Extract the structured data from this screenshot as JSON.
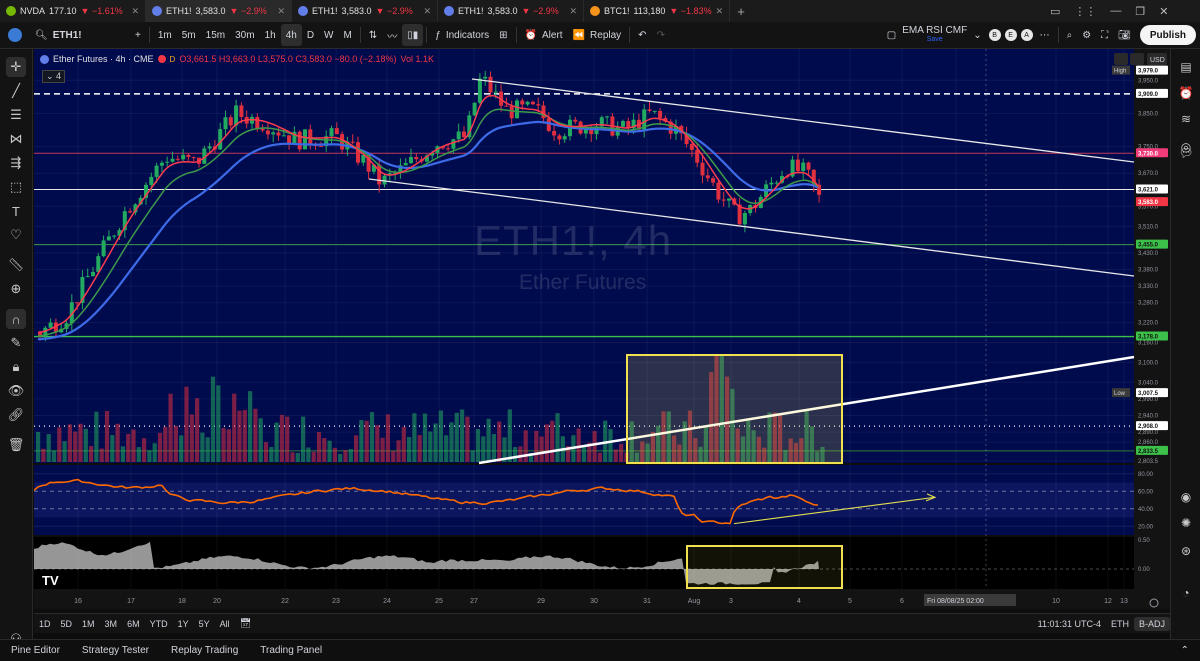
{
  "browser_tabs": [
    {
      "symbol": "NVDA",
      "price": "177.10",
      "change": "▼ −1.61%",
      "color": "#76b900"
    },
    {
      "symbol": "ETH1!",
      "price": "3,583.0",
      "change": "▼ −2.9%",
      "color": "#627eea",
      "active": true
    },
    {
      "symbol": "ETH1!",
      "price": "3,583.0",
      "change": "▼ −2.9%",
      "color": "#627eea"
    },
    {
      "symbol": "ETH1!",
      "price": "3,583.0",
      "change": "▼ −2.9%",
      "color": "#627eea"
    },
    {
      "symbol": "BTC1!",
      "price": "113,180",
      "change": "▼ −1.83%",
      "color": "#f7931a"
    }
  ],
  "toolbar": {
    "symbol": "ETH1!",
    "intervals": [
      "1m",
      "5m",
      "15m",
      "30m",
      "1h",
      "4h",
      "D",
      "W",
      "M"
    ],
    "selected_interval": "4h",
    "indicators_label": "Indicators",
    "alert_label": "Alert",
    "replay_label": "Replay",
    "layout_name": "EMA RSI CMF",
    "layout_status": "Save",
    "letters": [
      "B",
      "E",
      "A"
    ],
    "publish_label": "Publish"
  },
  "chart": {
    "title": "Ether Futures · 4h · CME",
    "ohlc": "O3,661.5  H3,663.0  L3,575.0  C3,583.0  −80.0 (−2.18%)",
    "vol": "Vol 1.1K",
    "collapse_count": "4",
    "watermark_symbol": "ETH1!, 4h",
    "watermark_name": "Ether Futures",
    "price_ticks": [
      "3,950.0",
      "3,850.0",
      "3,750.0",
      "3,670.0",
      "3,570.0",
      "3,510.0",
      "3,430.0",
      "3,380.0",
      "3,330.0",
      "3,280.0",
      "3,220.0",
      "3,160.0",
      "3,100.0",
      "3,040.0",
      "2,990.0",
      "2,940.0",
      "2,890.0",
      "2,860.0",
      "2,803.5"
    ],
    "price_labels": [
      {
        "text": "3,979.0",
        "kind": "high",
        "prefix": "High"
      },
      {
        "text": "3,909.0",
        "kind": "white"
      },
      {
        "text": "3,730.0",
        "kind": "pink"
      },
      {
        "text": "3,621.0",
        "kind": "white"
      },
      {
        "text": "3,583.0",
        "kind": "red"
      },
      {
        "text": "3,455.0",
        "kind": "green"
      },
      {
        "text": "3,178.0",
        "kind": "green"
      },
      {
        "text": "3,007.5",
        "kind": "low",
        "prefix": "Low"
      },
      {
        "text": "2,908.0",
        "kind": "white"
      },
      {
        "text": "2,833.5",
        "kind": "green"
      }
    ],
    "rsi_ticks": [
      "80.00",
      "60.00",
      "40.00",
      "20.00"
    ],
    "cmf_ticks": [
      "0.50",
      "0.00"
    ],
    "time_ticks": [
      "16",
      "17",
      "18",
      "20",
      "22",
      "23",
      "24",
      "25",
      "27",
      "29",
      "30",
      "31",
      "Aug",
      "3",
      "4",
      "5",
      "6",
      "7",
      "10",
      "12",
      "13"
    ],
    "crosshair_time": "Fri 08/08/25",
    "crosshair_clock": "02:00",
    "currency": "USD",
    "logo": "TV"
  },
  "colors": {
    "bg": "#000b4d",
    "up": "#22ab60",
    "down": "#e0303f",
    "ema_fast": "#ff3b4e",
    "ema_mid": "#3c9a4a",
    "ema_slow": "#3d6be8",
    "highlight": "#f0e050"
  },
  "rangebar": {
    "ranges": [
      "1D",
      "5D",
      "1M",
      "3M",
      "6M",
      "YTD",
      "1Y",
      "5Y",
      "All"
    ],
    "clock": "11:01:31 UTC-4",
    "symbol": "ETH",
    "adj": "B-ADJ"
  },
  "panels": [
    "Pine Editor",
    "Strategy Tester",
    "Replay Trading",
    "Trading Panel"
  ]
}
